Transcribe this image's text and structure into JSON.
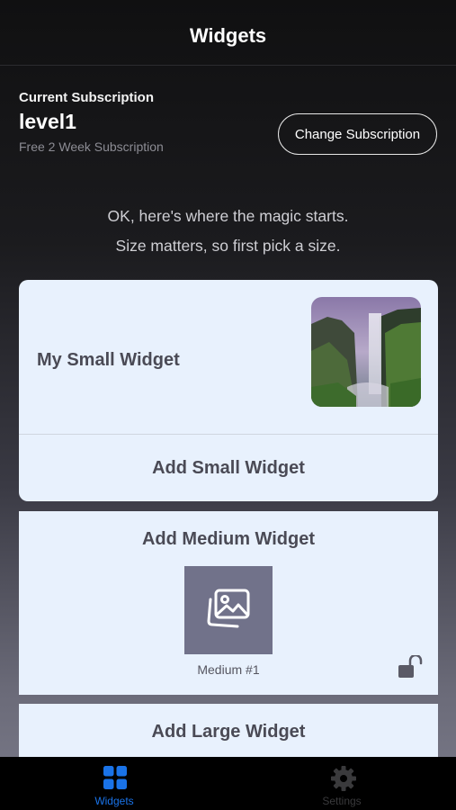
{
  "nav": {
    "title": "Widgets"
  },
  "subscription": {
    "caption": "Current Subscription",
    "level": "level1",
    "description": "Free 2 Week Subscription",
    "change_button": "Change Subscription"
  },
  "intro": {
    "line1": "OK, here's where the magic starts.",
    "line2": "Size matters, so first pick a size."
  },
  "small_widget": {
    "name": "My Small Widget",
    "add_label": "Add Small Widget"
  },
  "medium_widget": {
    "add_label": "Add Medium Widget",
    "item_caption": "Medium #1"
  },
  "large_widget": {
    "add_label": "Add Large Widget"
  },
  "tabs": [
    {
      "label": "Widgets",
      "icon": "grid-icon",
      "active": true
    },
    {
      "label": "Settings",
      "icon": "gear-icon",
      "active": false
    }
  ],
  "colors": {
    "accent": "#1a73e8",
    "card": "#e8f1fd",
    "tile": "#71728a"
  }
}
